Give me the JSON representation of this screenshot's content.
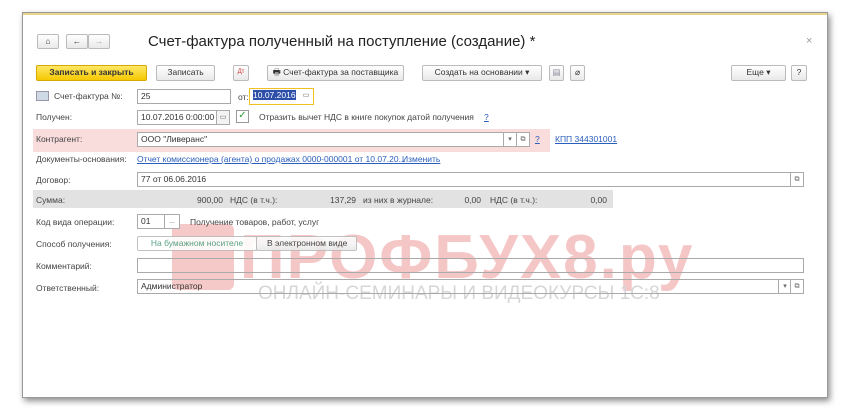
{
  "nav": {
    "home": "⌂",
    "back": "←",
    "forward": "→"
  },
  "title": "Счет-фактура полученный на поступление (создание) *",
  "close": "×",
  "toolbar": {
    "save_close": "Записать и закрыть",
    "save": "Записать",
    "invoice_supplier": "Счет-фактура за поставщика",
    "create_based": "Создать на основании",
    "more": "Еще",
    "help": "?"
  },
  "form": {
    "invoice_label": "Счет-фактура №:",
    "invoice_number": "25",
    "from_label": "от:",
    "invoice_date": "10.07.2016",
    "received_label": "Получен:",
    "received_value": "10.07.2016  0:00:00",
    "vat_checkbox_label": "Отразить вычет НДС в книге покупок датой получения",
    "vat_help": "?",
    "vat_checked": true,
    "counterparty_label": "Контрагент:",
    "counterparty_value": "ООО \"Ливеранс\"",
    "counterparty_help": "?",
    "kpp_link": "КПП 344301001",
    "basis_label": "Документы-основания:",
    "basis_link": "Отчет комиссионера (агента) о продажах 0000-000001 от 10.07.20...",
    "basis_change": "Изменить",
    "contract_label": "Договор:",
    "contract_value": "77 от 06.06.2016",
    "sum_label": "Сумма:",
    "sum_value": "900,00",
    "vat_label": "НДС (в т.ч.):",
    "vat_value": "137,29",
    "journal_label": "из них в журнале:",
    "journal_value": "0,00",
    "vat2_label": "НДС (в т.ч.):",
    "vat2_value": "0,00",
    "op_code_label": "Код вида операции:",
    "op_code_value": "01",
    "op_code_desc": "Получение товаров, работ, услуг",
    "method_label": "Способ получения:",
    "method_paper": "На бумажном носителе",
    "method_electronic": "В электронном виде",
    "comment_label": "Комментарий:",
    "comment_value": "",
    "responsible_label": "Ответственный:",
    "responsible_value": "Администратор"
  },
  "watermark": {
    "title": "ПРОФБУХ8.ру",
    "subtitle": "ОНЛАЙН-СЕМИНАРЫ И ВИДЕОКУРСЫ 1С:8"
  }
}
